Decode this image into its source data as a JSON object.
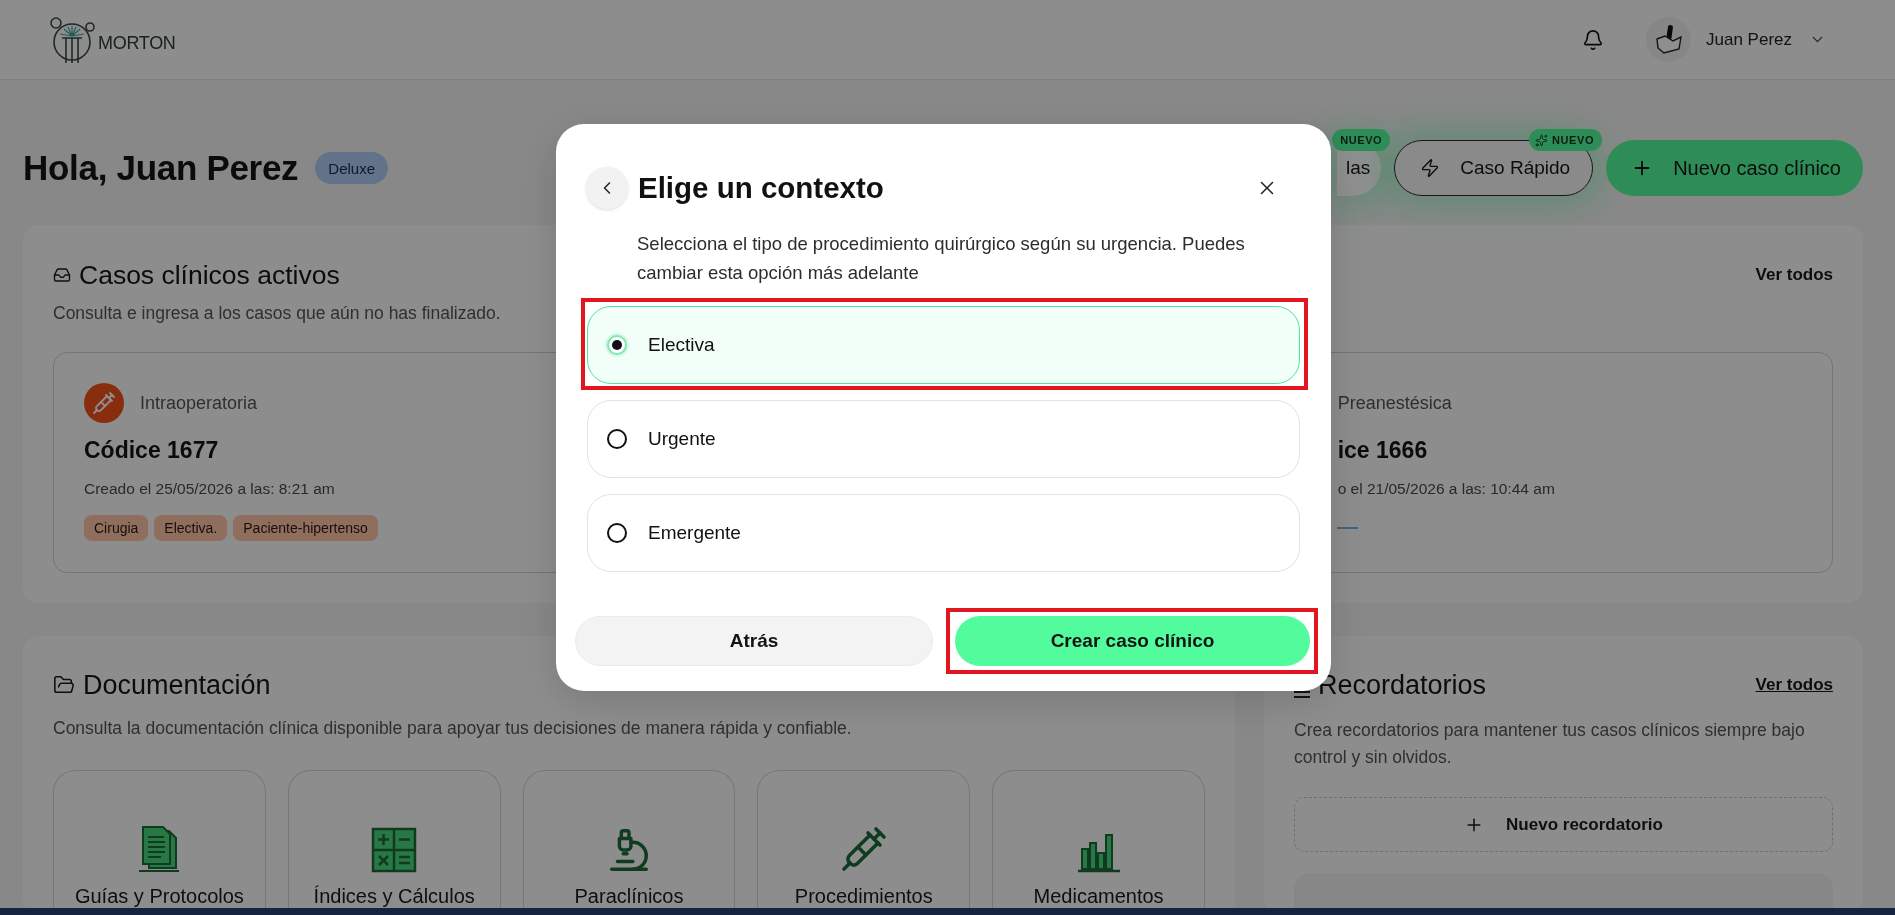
{
  "header": {
    "logo_text": "MORTON",
    "user_name": "Juan Perez"
  },
  "greeting": {
    "title": "Hola, Juan Perez",
    "plan_badge": "Deluxe"
  },
  "actions": [
    {
      "label": "las",
      "kind": "soft",
      "badge": "NUEVO",
      "covered": true
    },
    {
      "label": "Caso Rápido",
      "kind": "outline",
      "badge": "NUEVO",
      "covered": false
    },
    {
      "label": "Nuevo caso clínico",
      "kind": "primary",
      "covered": false
    }
  ],
  "active_cases": {
    "title": "Casos clínicos activos",
    "description": "Consulta e ingresa a los casos que aún no has finalizado.",
    "link": {
      "label": "Ver todos",
      "underlined": false
    },
    "cases": [
      {
        "type": "Intraoperatoria",
        "title": "Códice 1677",
        "created": "Creado el 25/05/2026 a las: 8:21 am",
        "tags": [
          "Cirugia",
          "Electiva.",
          "Paciente-hipertenso"
        ],
        "covered": false
      },
      {
        "type": "Preanestésica",
        "title": "ice 1666",
        "created": "o el 21/05/2026 a las: 10:44 am",
        "covered": true
      }
    ]
  },
  "documentation": {
    "title": "Documentación",
    "description": "Consulta la documentación clínica disponible para apoyar tus decisiones de manera rápida y confiable.",
    "tiles": [
      "Guías y Protocolos",
      "Índices y Cálculos",
      "Paraclínicos",
      "Procedimientos",
      "Medicamentos"
    ]
  },
  "reminders": {
    "title": "Recordatorios",
    "link": {
      "label": "Ver todos",
      "underlined": true
    },
    "description": "Crea recordatorios para mantener tus casos clínicos siempre bajo control y sin olvidos.",
    "new_button": "Nuevo recordatorio"
  },
  "modal": {
    "title": "Elige un contexto",
    "description": "Selecciona el tipo de procedimiento quirúrgico según su urgencia. Puedes cambiar esta opción más adelante",
    "options": [
      {
        "label": "Electiva",
        "selected": true,
        "annotated": true
      },
      {
        "label": "Urgente",
        "selected": false,
        "annotated": false
      },
      {
        "label": "Emergente",
        "selected": false,
        "annotated": false
      }
    ],
    "buttons": [
      {
        "label": "Atrás",
        "kind": "secondary",
        "annotated": false
      },
      {
        "label": "Crear caso clínico",
        "kind": "primary",
        "annotated": true
      }
    ]
  }
}
